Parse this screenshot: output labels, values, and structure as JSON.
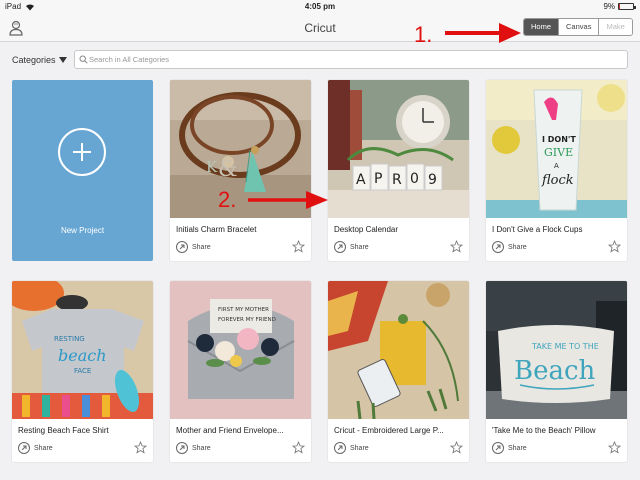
{
  "status_bar": {
    "device": "iPad",
    "time": "4:05 pm",
    "battery": "9%",
    "battery_level": 0.09
  },
  "nav": {
    "title": "Cricut",
    "segments": [
      "Home",
      "Canvas",
      "Make"
    ],
    "active_segment": "Home"
  },
  "annotations": {
    "one": "1.",
    "two": "2."
  },
  "search": {
    "categories_label": "Categories",
    "placeholder": "Search in All Categories"
  },
  "new_project": {
    "label": "New Project"
  },
  "projects": [
    {
      "title": "Initials Charm Bracelet",
      "share": "Share"
    },
    {
      "title": "Desktop Calendar",
      "share": "Share",
      "calendar_letters": [
        "A",
        "P",
        "R",
        "0",
        "9"
      ]
    },
    {
      "title": "I Don't Give a Flock Cups",
      "share": "Share"
    },
    {
      "title": "Resting Beach Face Shirt",
      "share": "Share"
    },
    {
      "title": "Mother and Friend Envelope...",
      "share": "Share"
    },
    {
      "title": "Cricut - Embroidered Large P...",
      "share": "Share"
    },
    {
      "title": "'Take Me to the Beach' Pillow",
      "share": "Share"
    }
  ],
  "colors": {
    "accent_blue": "#67a6d3",
    "annotation_red": "#e01010",
    "segment_active": "#555555"
  }
}
